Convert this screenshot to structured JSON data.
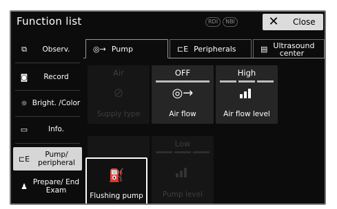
{
  "header": {
    "title": "Function list",
    "indicators": [
      "RDI",
      "NBI"
    ],
    "close_label": "Close"
  },
  "sidebar": {
    "items": [
      {
        "label": "Observ.",
        "icon": "observation-icon"
      },
      {
        "label": "Record",
        "icon": "record-icon"
      },
      {
        "label": "Bright. /Color",
        "icon": "brightness-icon"
      },
      {
        "label": "Info.",
        "icon": "info-icon"
      },
      {
        "label": "Pump/ peripheral",
        "icon": "pump-peripheral-icon",
        "active": true
      },
      {
        "label": "Prepare/ End Exam",
        "icon": "prepare-icon"
      }
    ]
  },
  "tabs": [
    {
      "label": "Pump",
      "icon": "pump-icon",
      "active": true
    },
    {
      "label": "Peripherals",
      "icon": "peripherals-icon"
    },
    {
      "label": "Ultrasound center",
      "icon": "ultrasound-icon"
    }
  ],
  "buttons": {
    "supply_type": {
      "top": "Air",
      "label": "Supply type"
    },
    "air_flow": {
      "top": "OFF",
      "label": "Air flow"
    },
    "air_flow_level": {
      "top": "High",
      "label": "Air flow level"
    },
    "flushing_pump": {
      "label": "Flushing pump"
    },
    "pump_level": {
      "top": "Low",
      "label": "Pump level"
    }
  }
}
